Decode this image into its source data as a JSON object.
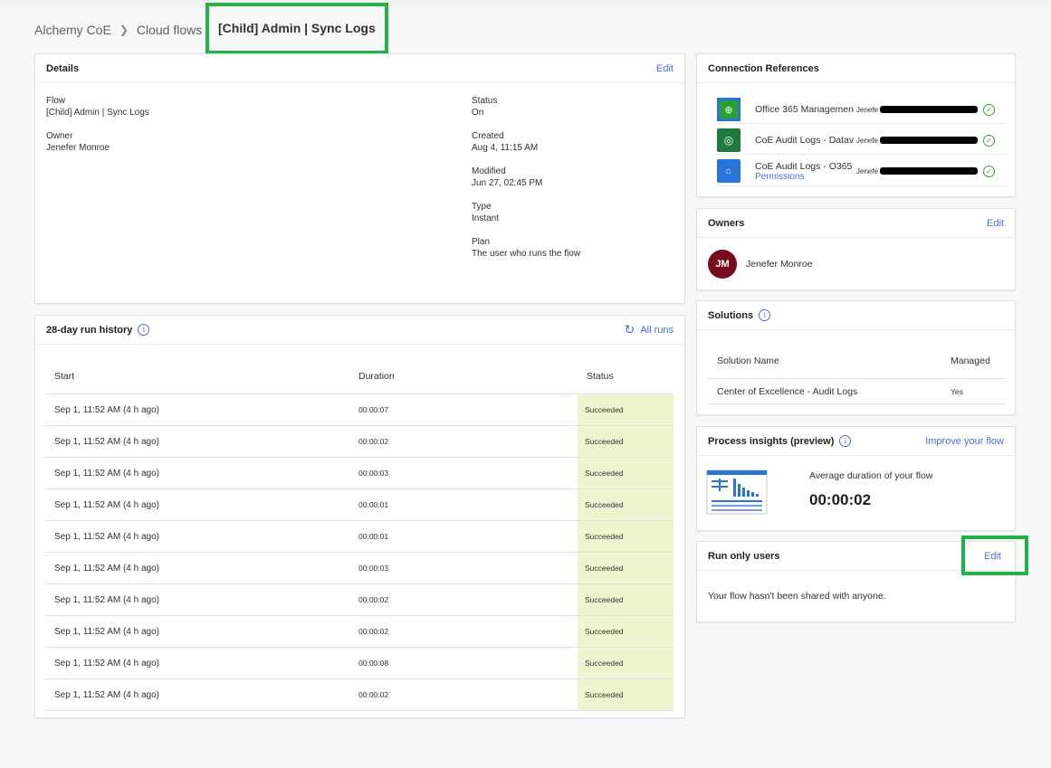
{
  "breadcrumb": {
    "items": [
      "Alchemy CoE",
      "Cloud flows"
    ],
    "current": "[Child] Admin | Sync Logs"
  },
  "details": {
    "title": "Details",
    "edit_label": "Edit",
    "flow_label": "Flow",
    "flow_value": "[Child] Admin | Sync Logs",
    "owner_label": "Owner",
    "owner_value": "Jenefer Monroe",
    "status_label": "Status",
    "status_value": "On",
    "created_label": "Created",
    "created_value": "Aug 4, 11:15 AM",
    "modified_label": "Modified",
    "modified_value": "Jun 27, 02:45 PM",
    "type_label": "Type",
    "type_value": "Instant",
    "plan_label": "Plan",
    "plan_value": "The user who runs the flow"
  },
  "run_history": {
    "title": "28-day run history",
    "all_runs_label": "All runs",
    "columns": [
      "Start",
      "Duration",
      "Status"
    ],
    "rows": [
      {
        "start": "Sep 1, 11:52 AM (4 h ago)",
        "duration": "00:00:07",
        "status": "Succeeded"
      },
      {
        "start": "Sep 1, 11:52 AM (4 h ago)",
        "duration": "00:00:02",
        "status": "Succeeded"
      },
      {
        "start": "Sep 1, 11:52 AM (4 h ago)",
        "duration": "00:00:03",
        "status": "Succeeded"
      },
      {
        "start": "Sep 1, 11:52 AM (4 h ago)",
        "duration": "00:00:01",
        "status": "Succeeded"
      },
      {
        "start": "Sep 1, 11:52 AM (4 h ago)",
        "duration": "00:00:01",
        "status": "Succeeded"
      },
      {
        "start": "Sep 1, 11:52 AM (4 h ago)",
        "duration": "00:00:03",
        "status": "Succeeded"
      },
      {
        "start": "Sep 1, 11:52 AM (4 h ago)",
        "duration": "00:00:02",
        "status": "Succeeded"
      },
      {
        "start": "Sep 1, 11:52 AM (4 h ago)",
        "duration": "00:00:02",
        "status": "Succeeded"
      },
      {
        "start": "Sep 1, 11:52 AM (4 h ago)",
        "duration": "00:00:08",
        "status": "Succeeded"
      },
      {
        "start": "Sep 1, 11:52 AM (4 h ago)",
        "duration": "00:00:02",
        "status": "Succeeded"
      }
    ]
  },
  "connection_refs": {
    "title": "Connection References",
    "items": [
      {
        "name": "Office 365 Managemen",
        "user": "Jenefe",
        "icon": "office365-management-icon",
        "color": "#2aa22a"
      },
      {
        "name": "CoE Audit Logs - Datav",
        "user": "Jenefe",
        "icon": "dataverse-icon",
        "color": "#1e7a3f"
      },
      {
        "name": "CoE Audit Logs - O365",
        "user": "Jenefe",
        "icon": "office365-users-icon",
        "color": "#2a74d6",
        "sub": "Permissions"
      }
    ]
  },
  "owners": {
    "title": "Owners",
    "edit_label": "Edit",
    "avatar_initials": "JM",
    "owner_name": "Jenefer Monroe"
  },
  "solutions": {
    "title": "Solutions",
    "col_name": "Solution Name",
    "col_managed": "Managed",
    "rows": [
      {
        "name": "Center of Excellence - Audit Logs",
        "managed": "Yes"
      }
    ]
  },
  "insights": {
    "title": "Process insights (preview)",
    "improve_label": "Improve your flow",
    "avg_label": "Average duration of your flow",
    "avg_value": "00:00:02"
  },
  "run_only": {
    "title": "Run only users",
    "edit_label": "Edit",
    "message": "Your flow hasn't been shared with anyone."
  },
  "colors": {
    "accent": "#4a6cd4",
    "highlight": "#1fb14a",
    "succeeded_bg": "#eff6cf",
    "avatar": "#750b1c"
  }
}
